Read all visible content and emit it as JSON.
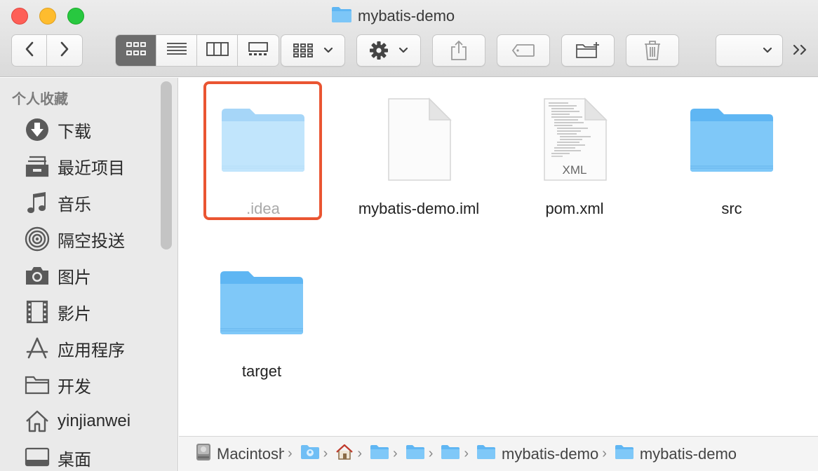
{
  "window": {
    "title": "mybatis-demo"
  },
  "toolbar": {
    "back_icon": "chevron-left-icon",
    "forward_icon": "chevron-right-icon",
    "view_modes": [
      "icon-view-icon",
      "list-view-icon",
      "column-view-icon",
      "gallery-view-icon"
    ],
    "active_view": "icon-view-icon",
    "group_icon": "group-icon",
    "action_icon": "gear-icon",
    "share_icon": "share-icon",
    "tag_icon": "tag-icon",
    "new_folder_icon": "new-folder-icon",
    "trash_icon": "trash-icon",
    "search_icon": "chevron-down-icon",
    "overflow_icon": "double-chevron-right-icon"
  },
  "sidebar": {
    "header": "个人收藏",
    "items": [
      {
        "label": "下载",
        "icon": "download-icon"
      },
      {
        "label": "最近项目",
        "icon": "recents-icon"
      },
      {
        "label": "音乐",
        "icon": "music-icon"
      },
      {
        "label": "隔空投送",
        "icon": "airdrop-icon"
      },
      {
        "label": "图片",
        "icon": "camera-icon"
      },
      {
        "label": "影片",
        "icon": "film-icon"
      },
      {
        "label": "应用程序",
        "icon": "applications-icon"
      },
      {
        "label": "开发",
        "icon": "folder-icon"
      },
      {
        "label": "yinjianwei",
        "icon": "home-icon"
      },
      {
        "label": "桌面",
        "icon": "desktop-icon"
      }
    ]
  },
  "files": [
    {
      "name": ".idea",
      "kind": "folder",
      "hidden": true,
      "selected": true
    },
    {
      "name": "mybatis-demo.iml",
      "kind": "document"
    },
    {
      "name": "pom.xml",
      "kind": "xml",
      "badge": "XML"
    },
    {
      "name": "src",
      "kind": "folder"
    },
    {
      "name": "target",
      "kind": "folder"
    }
  ],
  "pathbar": {
    "crumbs": [
      {
        "label": "Macintosh",
        "icon": "disk-icon"
      },
      {
        "label": "",
        "icon": "user-folder-icon"
      },
      {
        "label": "",
        "icon": "home-icon"
      },
      {
        "label": "",
        "icon": "folder-icon"
      },
      {
        "label": "",
        "icon": "folder-icon"
      },
      {
        "label": "",
        "icon": "folder-icon"
      },
      {
        "label": "mybatis-demo",
        "icon": "folder-icon"
      },
      {
        "label": "mybatis-demo",
        "icon": "folder-icon"
      }
    ],
    "separator": "›"
  },
  "colors": {
    "folder_light": "#a6d8fb",
    "folder_dark": "#5fb6f3",
    "selection": "#ea5532",
    "active_segment": "#6c6c6c"
  }
}
